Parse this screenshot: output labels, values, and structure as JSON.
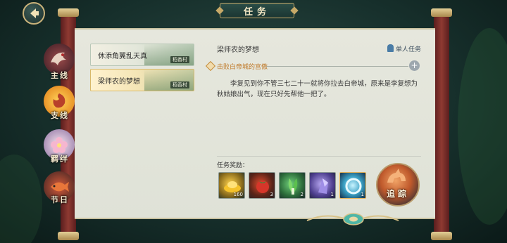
{
  "header": {
    "title": "任务"
  },
  "nav": [
    {
      "id": "main",
      "label": "主线"
    },
    {
      "id": "side",
      "label": "支线"
    },
    {
      "id": "bond",
      "label": "羁绊"
    },
    {
      "id": "festival",
      "label": "节日"
    }
  ],
  "quests": [
    {
      "title": "休添角翼乱天真",
      "location": "稻香村",
      "selected": false
    },
    {
      "title": "梁师农的梦想",
      "location": "稻香村",
      "selected": true
    }
  ],
  "detail": {
    "title": "梁师农的梦想",
    "mode_badge": "单人任务",
    "objective": "击败白帝城的宫傲",
    "description": "李复见到你不管三七二十一就将你拉去白帝城，原来是李复想为秋姑娘出气，现在只好先帮他一把了。"
  },
  "rewards": {
    "label": "任务奖励：",
    "items": [
      {
        "name": "gold-ingot",
        "count": "160"
      },
      {
        "name": "tomato",
        "count": "3"
      },
      {
        "name": "bok-choy",
        "count": "2"
      },
      {
        "name": "crystal",
        "count": "1"
      },
      {
        "name": "glowing-ring",
        "count": "1"
      }
    ]
  },
  "track_button": {
    "label": "追踪"
  },
  "colors": {
    "accent_gold": "#c7a968",
    "objective_orange": "#c07a2a",
    "panel_bg": "#e6e7dd",
    "rod_red": "#8e3a32"
  }
}
